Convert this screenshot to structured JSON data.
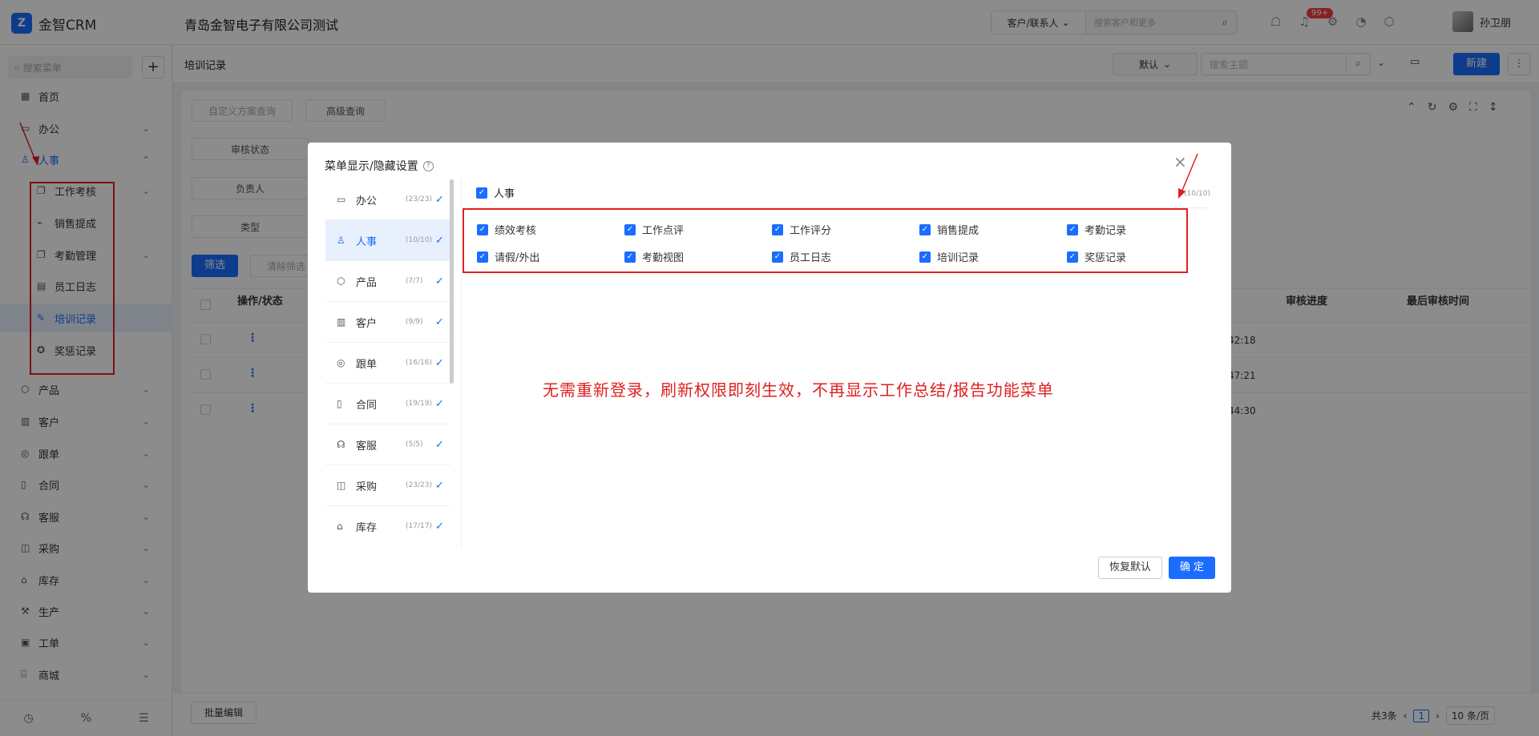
{
  "app": {
    "logo_mark": "Z",
    "logo_text": "金智CRM",
    "company": "青岛金智电子有限公司测试"
  },
  "topbar": {
    "search_type": "客户/联系人",
    "search_placeholder": "搜索客户和更多",
    "notification_badge": "99+",
    "user_name": "孙卫朋"
  },
  "sidebar": {
    "search_placeholder": "搜索菜单",
    "items": [
      {
        "label": "首页",
        "icon": "home-icon"
      },
      {
        "label": "办公",
        "icon": "office-icon"
      },
      {
        "label": "人事",
        "icon": "hr-icon"
      },
      {
        "label": "工作考核",
        "icon": "copy-icon"
      },
      {
        "label": "销售提成",
        "icon": "chart-icon"
      },
      {
        "label": "考勤管理",
        "icon": "copy-icon"
      },
      {
        "label": "员工日志",
        "icon": "calendar-icon"
      },
      {
        "label": "培训记录",
        "icon": "edit-icon"
      },
      {
        "label": "奖惩记录",
        "icon": "award-icon"
      },
      {
        "label": "产品",
        "icon": "box-icon"
      },
      {
        "label": "客户",
        "icon": "building-icon"
      },
      {
        "label": "跟单",
        "icon": "target-icon"
      },
      {
        "label": "合同",
        "icon": "contract-icon"
      },
      {
        "label": "客服",
        "icon": "headset-icon"
      },
      {
        "label": "采购",
        "icon": "bag-icon"
      },
      {
        "label": "库存",
        "icon": "warehouse-icon"
      },
      {
        "label": "生产",
        "icon": "factory-icon"
      },
      {
        "label": "工单",
        "icon": "ticket-icon"
      },
      {
        "label": "商城",
        "icon": "shop-icon"
      }
    ]
  },
  "header": {
    "page_title": "培训记录",
    "view_select": "默认",
    "theme_placeholder": "搜索主题",
    "new_button": "新建"
  },
  "filters": {
    "scheme_placeholder": "自定义方案查询",
    "advanced": "高级查询",
    "audit_status": "审核状态",
    "owner": "负责人",
    "type": "类型",
    "filter_btn": "筛选",
    "clear_btn": "清除筛选"
  },
  "table": {
    "col_action": "操作/状态",
    "col_audit_progress": "审核进度",
    "col_last_audit_time": "最后审核时间",
    "row_times": [
      "42:18",
      "47:21",
      "44:30"
    ]
  },
  "footer": {
    "batch_edit": "批量编辑",
    "total": "共3条",
    "page": "1",
    "page_size": "10 条/页"
  },
  "modal": {
    "title": "菜单显示/隐藏设置",
    "categories": [
      {
        "label": "办公",
        "count": "(23/23)",
        "icon": "office-icon"
      },
      {
        "label": "人事",
        "count": "(10/10)",
        "icon": "hr-icon"
      },
      {
        "label": "产品",
        "count": "(7/7)",
        "icon": "box-icon"
      },
      {
        "label": "客户",
        "count": "(9/9)",
        "icon": "building-icon"
      },
      {
        "label": "跟单",
        "count": "(16/16)",
        "icon": "target-icon"
      },
      {
        "label": "合同",
        "count": "(19/19)",
        "icon": "contract-icon"
      },
      {
        "label": "客服",
        "count": "(5/5)",
        "icon": "headset-icon"
      },
      {
        "label": "采购",
        "count": "(23/23)",
        "icon": "bag-icon"
      },
      {
        "label": "库存",
        "count": "(17/17)",
        "icon": "warehouse-icon"
      }
    ],
    "section_label": "人事",
    "section_count": "(10/10)",
    "permissions": [
      "绩效考核",
      "工作点评",
      "工作评分",
      "销售提成",
      "考勤记录",
      "请假/外出",
      "考勤视图",
      "员工日志",
      "培训记录",
      "奖惩记录"
    ],
    "notice": "无需重新登录，刷新权限即刻生效，不再显示工作总结/报告功能菜单",
    "reset_button": "恢复默认",
    "ok_button": "确 定"
  },
  "colors": {
    "accent": "#1a6dff",
    "annotation": "#e02020"
  }
}
